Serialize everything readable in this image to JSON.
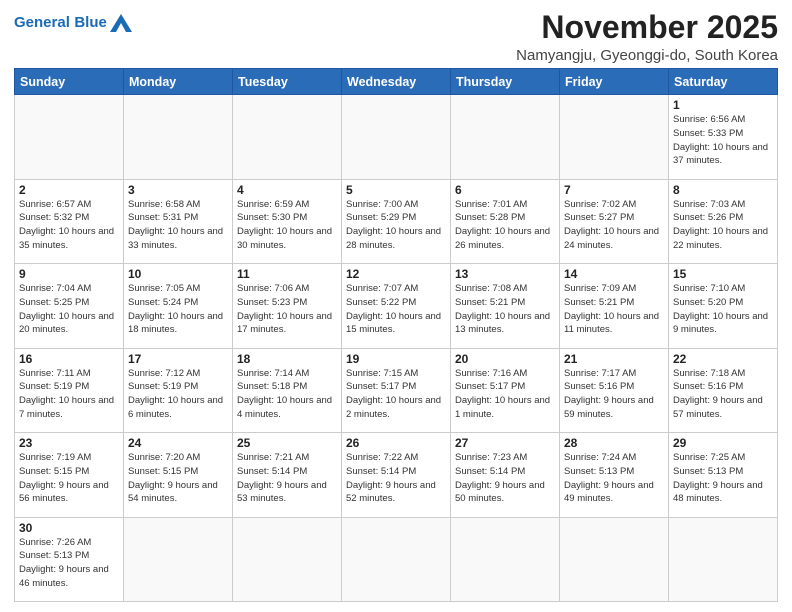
{
  "header": {
    "logo_general": "General",
    "logo_blue": "Blue",
    "month_title": "November 2025",
    "subtitle": "Namyangju, Gyeonggi-do, South Korea"
  },
  "weekdays": [
    "Sunday",
    "Monday",
    "Tuesday",
    "Wednesday",
    "Thursday",
    "Friday",
    "Saturday"
  ],
  "weeks": [
    [
      {
        "day": null
      },
      {
        "day": null
      },
      {
        "day": null
      },
      {
        "day": null
      },
      {
        "day": null
      },
      {
        "day": null
      },
      {
        "day": 1,
        "sunrise": "6:56 AM",
        "sunset": "5:33 PM",
        "daylight": "10 hours and 37 minutes."
      }
    ],
    [
      {
        "day": 2,
        "sunrise": "6:57 AM",
        "sunset": "5:32 PM",
        "daylight": "10 hours and 35 minutes."
      },
      {
        "day": 3,
        "sunrise": "6:58 AM",
        "sunset": "5:31 PM",
        "daylight": "10 hours and 33 minutes."
      },
      {
        "day": 4,
        "sunrise": "6:59 AM",
        "sunset": "5:30 PM",
        "daylight": "10 hours and 30 minutes."
      },
      {
        "day": 5,
        "sunrise": "7:00 AM",
        "sunset": "5:29 PM",
        "daylight": "10 hours and 28 minutes."
      },
      {
        "day": 6,
        "sunrise": "7:01 AM",
        "sunset": "5:28 PM",
        "daylight": "10 hours and 26 minutes."
      },
      {
        "day": 7,
        "sunrise": "7:02 AM",
        "sunset": "5:27 PM",
        "daylight": "10 hours and 24 minutes."
      },
      {
        "day": 8,
        "sunrise": "7:03 AM",
        "sunset": "5:26 PM",
        "daylight": "10 hours and 22 minutes."
      }
    ],
    [
      {
        "day": 9,
        "sunrise": "7:04 AM",
        "sunset": "5:25 PM",
        "daylight": "10 hours and 20 minutes."
      },
      {
        "day": 10,
        "sunrise": "7:05 AM",
        "sunset": "5:24 PM",
        "daylight": "10 hours and 18 minutes."
      },
      {
        "day": 11,
        "sunrise": "7:06 AM",
        "sunset": "5:23 PM",
        "daylight": "10 hours and 17 minutes."
      },
      {
        "day": 12,
        "sunrise": "7:07 AM",
        "sunset": "5:22 PM",
        "daylight": "10 hours and 15 minutes."
      },
      {
        "day": 13,
        "sunrise": "7:08 AM",
        "sunset": "5:21 PM",
        "daylight": "10 hours and 13 minutes."
      },
      {
        "day": 14,
        "sunrise": "7:09 AM",
        "sunset": "5:21 PM",
        "daylight": "10 hours and 11 minutes."
      },
      {
        "day": 15,
        "sunrise": "7:10 AM",
        "sunset": "5:20 PM",
        "daylight": "10 hours and 9 minutes."
      }
    ],
    [
      {
        "day": 16,
        "sunrise": "7:11 AM",
        "sunset": "5:19 PM",
        "daylight": "10 hours and 7 minutes."
      },
      {
        "day": 17,
        "sunrise": "7:12 AM",
        "sunset": "5:19 PM",
        "daylight": "10 hours and 6 minutes."
      },
      {
        "day": 18,
        "sunrise": "7:14 AM",
        "sunset": "5:18 PM",
        "daylight": "10 hours and 4 minutes."
      },
      {
        "day": 19,
        "sunrise": "7:15 AM",
        "sunset": "5:17 PM",
        "daylight": "10 hours and 2 minutes."
      },
      {
        "day": 20,
        "sunrise": "7:16 AM",
        "sunset": "5:17 PM",
        "daylight": "10 hours and 1 minute."
      },
      {
        "day": 21,
        "sunrise": "7:17 AM",
        "sunset": "5:16 PM",
        "daylight": "9 hours and 59 minutes."
      },
      {
        "day": 22,
        "sunrise": "7:18 AM",
        "sunset": "5:16 PM",
        "daylight": "9 hours and 57 minutes."
      }
    ],
    [
      {
        "day": 23,
        "sunrise": "7:19 AM",
        "sunset": "5:15 PM",
        "daylight": "9 hours and 56 minutes."
      },
      {
        "day": 24,
        "sunrise": "7:20 AM",
        "sunset": "5:15 PM",
        "daylight": "9 hours and 54 minutes."
      },
      {
        "day": 25,
        "sunrise": "7:21 AM",
        "sunset": "5:14 PM",
        "daylight": "9 hours and 53 minutes."
      },
      {
        "day": 26,
        "sunrise": "7:22 AM",
        "sunset": "5:14 PM",
        "daylight": "9 hours and 52 minutes."
      },
      {
        "day": 27,
        "sunrise": "7:23 AM",
        "sunset": "5:14 PM",
        "daylight": "9 hours and 50 minutes."
      },
      {
        "day": 28,
        "sunrise": "7:24 AM",
        "sunset": "5:13 PM",
        "daylight": "9 hours and 49 minutes."
      },
      {
        "day": 29,
        "sunrise": "7:25 AM",
        "sunset": "5:13 PM",
        "daylight": "9 hours and 48 minutes."
      }
    ],
    [
      {
        "day": 30,
        "sunrise": "7:26 AM",
        "sunset": "5:13 PM",
        "daylight": "9 hours and 46 minutes."
      },
      {
        "day": null
      },
      {
        "day": null
      },
      {
        "day": null
      },
      {
        "day": null
      },
      {
        "day": null
      },
      {
        "day": null
      }
    ]
  ]
}
